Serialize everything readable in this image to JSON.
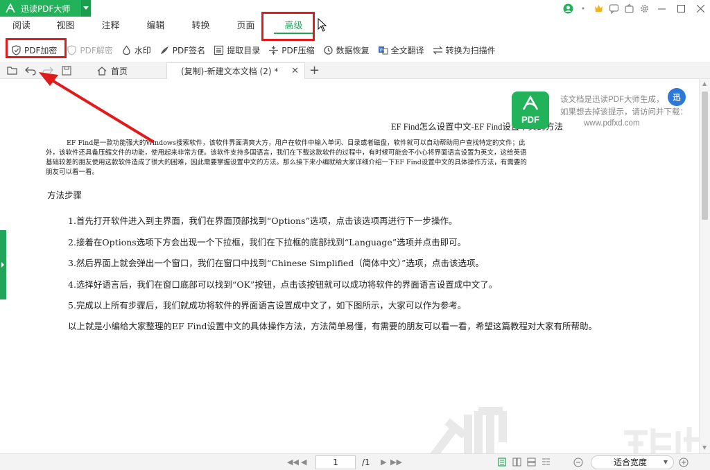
{
  "app": {
    "name": "迅读PDF大师"
  },
  "menu": {
    "tabs": [
      {
        "label": "阅读"
      },
      {
        "label": "视图"
      },
      {
        "label": "注释"
      },
      {
        "label": "编辑"
      },
      {
        "label": "转换"
      },
      {
        "label": "页面"
      },
      {
        "label": "高级",
        "active": true
      }
    ]
  },
  "toolbar": {
    "buttons": [
      {
        "label": "PDF加密",
        "icon": "shield-check-icon"
      },
      {
        "label": "PDF解密",
        "icon": "shield-icon",
        "disabled": true
      },
      {
        "label": "水印",
        "icon": "drop-icon"
      },
      {
        "label": "PDF签名",
        "icon": "pen-icon"
      },
      {
        "label": "提取目录",
        "icon": "list-icon"
      },
      {
        "label": "PDF压缩",
        "icon": "compress-icon"
      },
      {
        "label": "数据恢复",
        "icon": "recover-icon"
      },
      {
        "label": "全文翻译",
        "icon": "translate-icon"
      },
      {
        "label": "转换为扫描件",
        "icon": "convert-icon"
      }
    ]
  },
  "tabs": {
    "home_label": "首页",
    "doc_label": "(复制)-新建文本文档 (2) *"
  },
  "document": {
    "title": "EF Find怎么设置中文-EF Find设置中文的方法",
    "intro": "EF Find是一款功能强大的Windows搜索软件，该软件界面清爽大方，用户在软件中输入单词、目录或者磁盘，软件就可以自动帮助用户查找特定的文件；此外，该软件还具备压缩文件的功能，使用起来非常方便。该软件支持多国语言，我们在下载这款软件的过程中，有时候可能会不小心将界面语言设置为英文，这给英语基础较差的朋友使用这款软件造成了很大的困难，因此需要掌握设置中文的方法。那么接下来小编就给大家详细介绍一下EF Find设置中文的具体操作方法，有需要的朋友可以看一看。",
    "section_heading": "方法步骤",
    "steps": [
      "1.首先打开软件进入到主界面，我们在界面顶部找到“Options”选项，点击该选项再进行下一步操作。",
      "2.接着在Options选项下方会出现一个下拉框，我们在下拉框的底部找到“Language”选项并点击即可。",
      "3.然后界面上就会弹出一个窗口，我们在窗口中找到“Chinese Simplified（简体中文）”选项，点击该选项。",
      "4.选择好语言后，我们在窗口底部可以找到“OK”按钮，点击该按钮就可以成功将软件的界面语言设置成中文了。",
      "5.完成以上所有步骤后，我们就成功将软件的界面语言设置成中文了，如下图所示，大家可以作为参考。",
      "以上就是小编给大家整理的EF Find设置中文的具体操作方法，方法简单易懂，有需要的朋友可以看一看，希望这篇教程对大家有所帮助。"
    ]
  },
  "watermark": {
    "logo_text": "PDF",
    "line1": "该文档是迅读PDF大师生成，",
    "line2": "如果想去掉该提示，请访问并下载：",
    "url": "www.pdfxd.com",
    "badge": "迅"
  },
  "statusbar": {
    "page_current": "1",
    "page_total": "/1",
    "zoom": "适合宽度"
  },
  "colors": {
    "accent": "#22a55a",
    "highlight": "#e01b1b"
  }
}
